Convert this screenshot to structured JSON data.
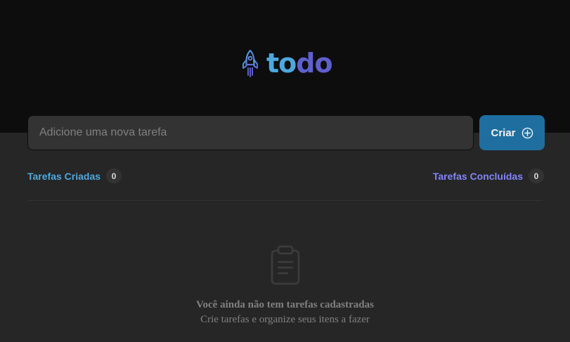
{
  "header": {
    "logo": {
      "part1": "to",
      "part2": "do",
      "icon": "rocket-icon"
    }
  },
  "form": {
    "input_placeholder": "Adicione uma nova tarefa",
    "input_value": "",
    "create_button_label": "Criar",
    "create_button_icon": "plus-circle-icon"
  },
  "counters": {
    "created": {
      "label": "Tarefas Criadas",
      "count": "0"
    },
    "completed": {
      "label": "Tarefas Concluídas",
      "count": "0"
    }
  },
  "empty_state": {
    "icon": "clipboard-icon",
    "title": "Você ainda não tem tarefas cadastradas",
    "subtitle": "Crie tarefas e organize seus itens a fazer"
  },
  "colors": {
    "header_bg": "#0d0d0d",
    "page_bg": "#262626",
    "input_bg": "#333333",
    "primary_blue": "#4ea8de",
    "primary_purple": "#5e60ce",
    "button_bg": "#1e6f9f",
    "purple_light": "#8284fa",
    "muted_text": "#808080"
  }
}
